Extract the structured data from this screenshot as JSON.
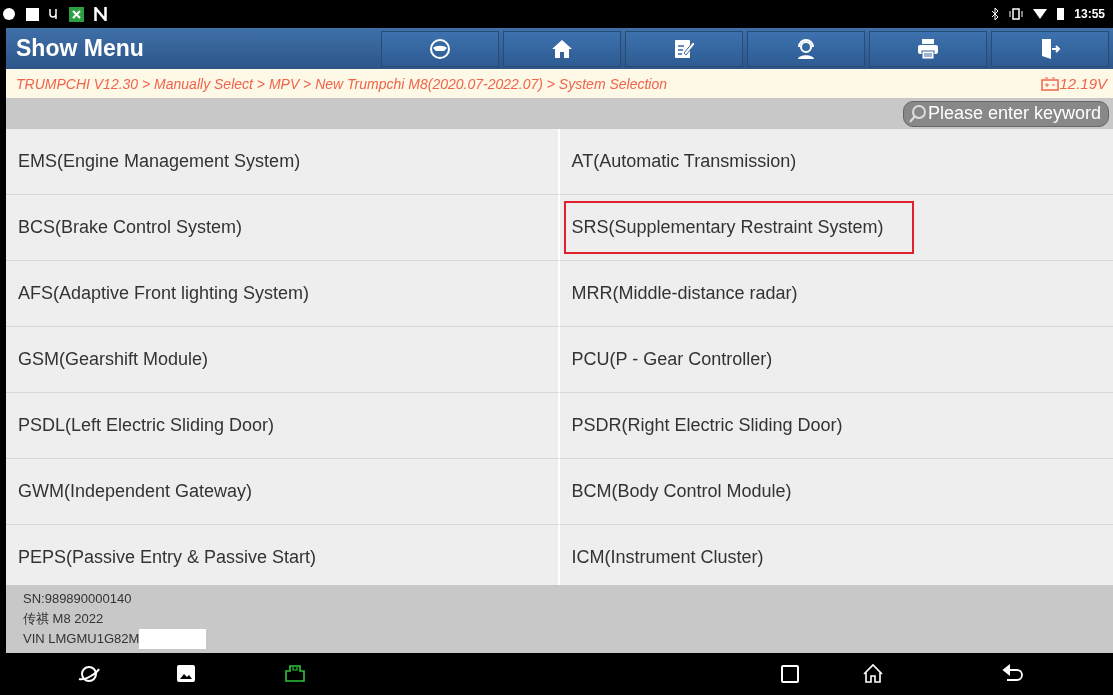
{
  "status_bar": {
    "time": "13:55"
  },
  "header": {
    "title": "Show Menu"
  },
  "breadcrumb": {
    "path": "TRUMPCHI V12.30 > Manually Select > MPV > New Trumpchi M8(2020.07-2022.07) > System Selection",
    "voltage": "12.19V"
  },
  "search": {
    "placeholder": "Please enter keyword"
  },
  "systems": [
    {
      "label": "EMS(Engine Management System)",
      "highlighted": false
    },
    {
      "label": "AT(Automatic Transmission)",
      "highlighted": false
    },
    {
      "label": "BCS(Brake Control System)",
      "highlighted": false
    },
    {
      "label": "SRS(Supplementary Restraint System)",
      "highlighted": true
    },
    {
      "label": "AFS(Adaptive Front lighting System)",
      "highlighted": false
    },
    {
      "label": "MRR(Middle-distance radar)",
      "highlighted": false
    },
    {
      "label": "GSM(Gearshift Module)",
      "highlighted": false
    },
    {
      "label": "PCU(P - Gear Controller)",
      "highlighted": false
    },
    {
      "label": "PSDL(Left Electric Sliding Door)",
      "highlighted": false
    },
    {
      "label": "PSDR(Right Electric Sliding Door)",
      "highlighted": false
    },
    {
      "label": "GWM(Independent Gateway)",
      "highlighted": false
    },
    {
      "label": "BCM(Body Control Module)",
      "highlighted": false
    },
    {
      "label": "PEPS(Passive Entry & Passive Start)",
      "highlighted": false
    },
    {
      "label": "ICM(Instrument Cluster)",
      "highlighted": false
    }
  ],
  "vehicle_info": {
    "serial": "SN:989890000140",
    "model": "传祺 M8 2022",
    "vin": "VIN LMGMU1G82M"
  }
}
